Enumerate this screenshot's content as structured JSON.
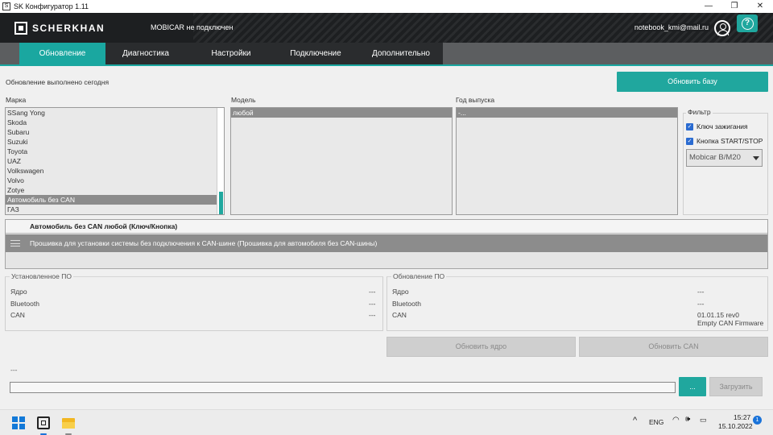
{
  "window": {
    "title": "SK Конфигуратор 1.11",
    "icon": "app-icon",
    "controls": [
      "—",
      "❐",
      "✕"
    ]
  },
  "header": {
    "logo_text": "SCHERKHAN",
    "connection_status": "MOBICAR не подключен",
    "user_email": "notebook_kmi@mail.ru",
    "help_label": "?"
  },
  "tabs": [
    {
      "label": "Обновление",
      "active": true
    },
    {
      "label": "Диагностика",
      "active": false
    },
    {
      "label": "Настройки",
      "active": false
    },
    {
      "label": "Подключение",
      "active": false
    },
    {
      "label": "Дополнительно",
      "active": false
    }
  ],
  "update": {
    "status_text": "Обновление выполнено сегодня",
    "update_db_button": "Обновить базу"
  },
  "make": {
    "label": "Марка",
    "items": [
      "SSang Yong",
      "Skoda",
      "Subaru",
      "Suzuki",
      "Toyota",
      "UAZ",
      "Volkswagen",
      "Volvo",
      "Zotye",
      "Автомобиль без CAN",
      "ГАЗ"
    ],
    "selected": "Автомобиль без CAN"
  },
  "model": {
    "label": "Модель",
    "items": [
      "любой"
    ],
    "selected": "любой"
  },
  "year": {
    "label": "Год выпуска",
    "items": [
      "-..."
    ],
    "selected": "-..."
  },
  "filter": {
    "label": "Фильтр",
    "ignition_key": "Ключ зажигания",
    "start_stop": "Кнопка START/STOP",
    "device_selected": "Mobicar B/M20",
    "accent": "#20a79e"
  },
  "firmware": {
    "header": "Автомобиль без CAN любой (Ключ/Кнопка)",
    "row": "Прошивка для установки системы без подключения к CAN-шине  (Прошивка для автомобиля без CAN-шины)"
  },
  "installed": {
    "title": "Установленное ПО",
    "rows": [
      {
        "name": "Ядро",
        "value": "---"
      },
      {
        "name": "Bluetooth",
        "value": "---"
      },
      {
        "name": "CAN",
        "value": "---"
      }
    ]
  },
  "available": {
    "title": "Обновление ПО",
    "rows": [
      {
        "name": "Ядро",
        "value": "---"
      },
      {
        "name": "Bluetooth",
        "value": "---"
      },
      {
        "name": "CAN",
        "value": "01.01.15 rev0",
        "value2": "Empty CAN Firmware"
      }
    ]
  },
  "actions": {
    "update_core": "Обновить ядро",
    "update_can": "Обновить CAN",
    "file_status": "---",
    "browse": "...",
    "load": "Загрузить"
  },
  "taskbar": {
    "language": "ENG",
    "time": "15:27",
    "date": "15.10.2022",
    "notifications": "1",
    "chevron": "^"
  }
}
